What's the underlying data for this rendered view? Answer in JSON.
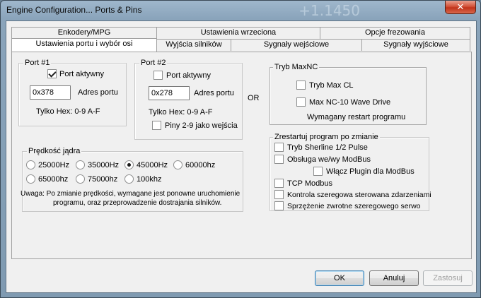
{
  "window": {
    "title": "Engine Configuration... Ports & Pins",
    "close_glyph": "✕",
    "background_number": "+1.1450"
  },
  "tabs": {
    "row1": [
      "Enkodery/MPG",
      "Ustawienia wrzeciona",
      "Opcje frezowania"
    ],
    "row2": [
      "Ustawienia portu i wybór osi",
      "Wyjścia silników",
      "Sygnały wejściowe",
      "Sygnały wyjściowe"
    ],
    "active": "Ustawienia portu i wybór osi"
  },
  "port1": {
    "legend": "Port #1",
    "active_label": "Port aktywny",
    "active_checked": true,
    "address_value": "0x378",
    "address_label": "Adres portu",
    "hex_note": "Tylko Hex: 0-9 A-F"
  },
  "port2": {
    "legend": "Port #2",
    "active_label": "Port aktywny",
    "active_checked": false,
    "address_value": "0x278",
    "address_label": "Adres portu",
    "hex_note": "Tylko Hex: 0-9 A-F",
    "pins_label": "Piny 2-9 jako wejścia",
    "pins_checked": false
  },
  "or_label": "OR",
  "maxnc": {
    "legend": "Tryb MaxNC",
    "opt1_label": "Tryb Max CL",
    "opt2_label": "Max NC-10 Wave Drive",
    "note": "Wymagany restart programu"
  },
  "speed": {
    "legend": "Prędkość jądra",
    "options": [
      "25000Hz",
      "35000Hz",
      "45000Hz",
      "60000hz",
      "65000hz",
      "75000hz",
      "100khz"
    ],
    "selected": "45000Hz",
    "note_line1": "Uwaga: Po zmianie prędkości, wymagane jest ponowne uruchomienie",
    "note_line2": "programu, oraz przeprowadzenie dostrajania silników."
  },
  "restart_group": {
    "legend": "Zrestartuj program po zmianie",
    "opt_sherline": "Tryb Sherline 1/2 Pulse",
    "opt_modbus": "Obsługa we/wy ModBus",
    "opt_plugin": "Włącz Plugin dla ModBus",
    "opt_tcp": "TCP Modbus",
    "opt_serial": "Kontrola szeregowa sterowana zdarzeniami",
    "opt_servo": "Sprzężenie zwrotne  szeregowego serwo"
  },
  "buttons": {
    "ok": "OK",
    "cancel": "Anuluj",
    "apply": "Zastosuj"
  }
}
